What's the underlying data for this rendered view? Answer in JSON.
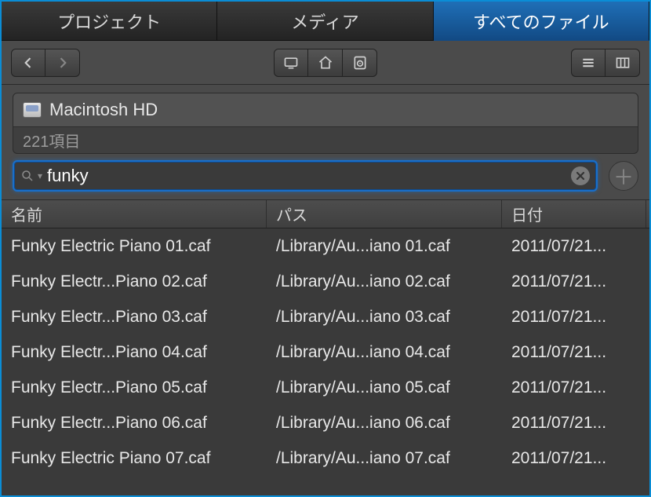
{
  "tabs": [
    {
      "label": "プロジェクト",
      "active": false
    },
    {
      "label": "メディア",
      "active": false
    },
    {
      "label": "すべてのファイル",
      "active": true
    }
  ],
  "location": {
    "volume": "Macintosh HD",
    "item_count": "221項目"
  },
  "search": {
    "value": "funky"
  },
  "columns": {
    "name": "名前",
    "path": "パス",
    "date": "日付"
  },
  "rows": [
    {
      "name": "Funky Electric Piano 01.caf",
      "path": "/Library/Au...iano 01.caf",
      "date": "2011/07/21..."
    },
    {
      "name": "Funky Electr...Piano 02.caf",
      "path": "/Library/Au...iano 02.caf",
      "date": "2011/07/21..."
    },
    {
      "name": "Funky Electr...Piano 03.caf",
      "path": "/Library/Au...iano 03.caf",
      "date": "2011/07/21..."
    },
    {
      "name": "Funky Electr...Piano 04.caf",
      "path": "/Library/Au...iano 04.caf",
      "date": "2011/07/21..."
    },
    {
      "name": "Funky Electr...Piano 05.caf",
      "path": "/Library/Au...iano 05.caf",
      "date": "2011/07/21..."
    },
    {
      "name": "Funky Electr...Piano 06.caf",
      "path": "/Library/Au...iano 06.caf",
      "date": "2011/07/21..."
    },
    {
      "name": "Funky Electric Piano 07.caf",
      "path": "/Library/Au...iano 07.caf",
      "date": "2011/07/21..."
    }
  ]
}
